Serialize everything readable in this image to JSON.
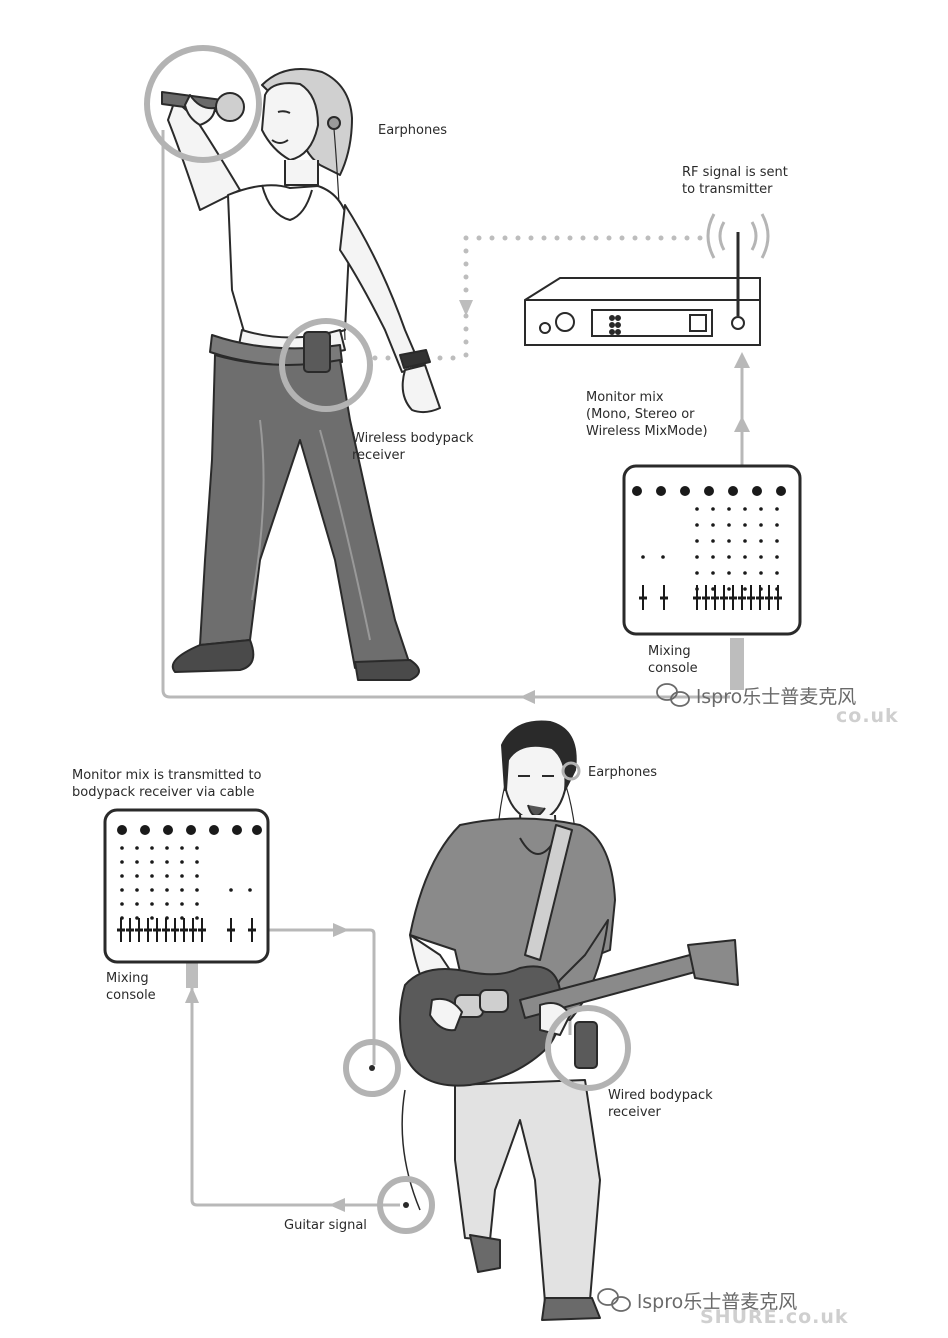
{
  "top_scene": {
    "earphones_label": "Earphones",
    "rf_signal_label": "RF signal is sent\nto transmitter",
    "bodypack_label": "Wireless bodypack\nreceiver",
    "monitor_mix_label": "Monitor mix\n(Mono, Stereo or\nWireless MixMode)",
    "mixing_console_label": "Mixing\nconsole"
  },
  "bottom_scene": {
    "monitor_mix_cable_label": "Monitor mix is transmitted to\nbodypack receiver via cable",
    "earphones_label": "Earphones",
    "mixing_console_label": "Mixing\nconsole",
    "wired_bodypack_label": "Wired bodypack\nreceiver",
    "guitar_signal_label": "Guitar signal"
  },
  "watermarks": {
    "wechat_text": "lspro乐士普麦克风",
    "site_text_top": "co.uk",
    "site_text_bottom": "SHURE.co.uk"
  },
  "colors": {
    "line": "#b5b5b5",
    "ink": "#2a2a2a",
    "skin": "#f4f4f4",
    "jeans": "#6e6e6e",
    "shirt": "#8a8a8a"
  }
}
